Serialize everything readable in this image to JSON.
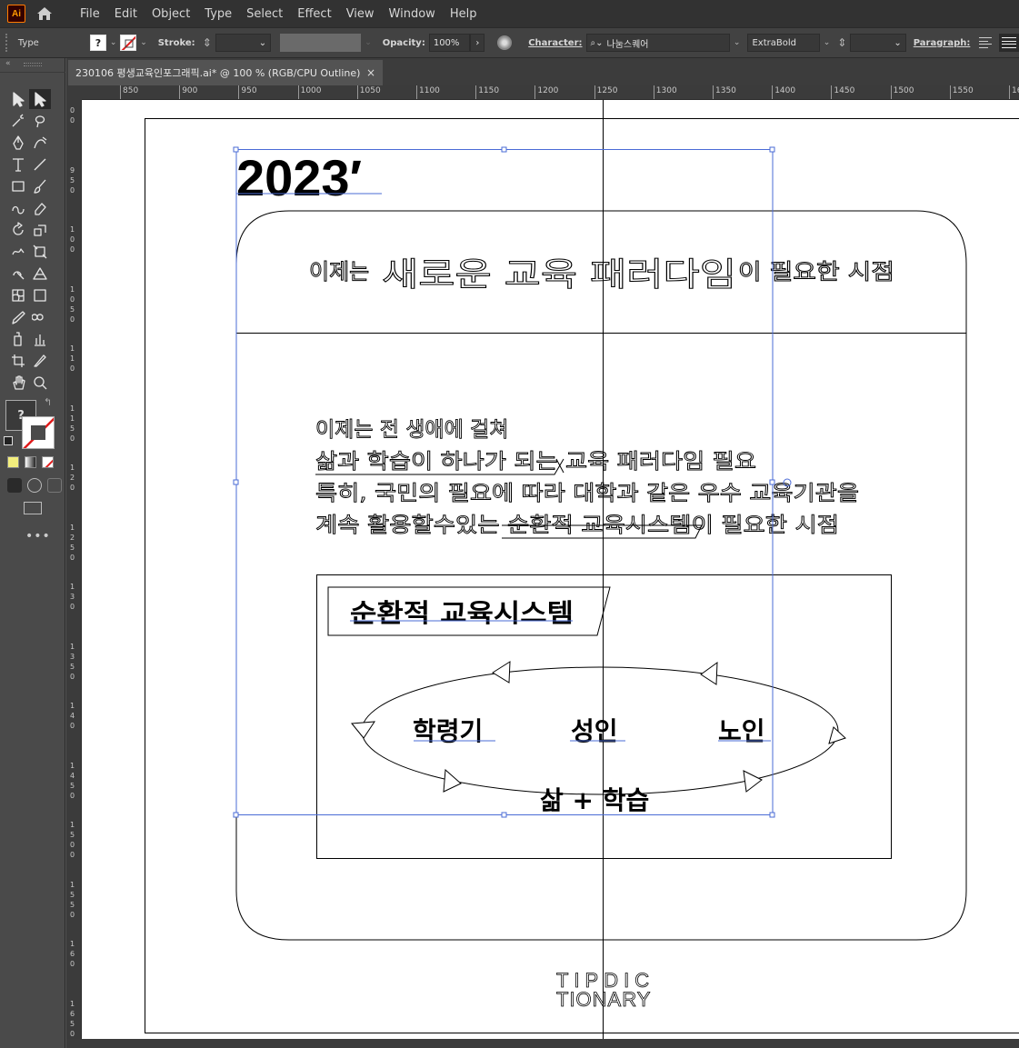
{
  "app": {
    "logo": "Ai",
    "menu": [
      "File",
      "Edit",
      "Object",
      "Type",
      "Select",
      "Effect",
      "View",
      "Window",
      "Help"
    ]
  },
  "control_bar": {
    "mode": "Type",
    "stroke_label": "Stroke:",
    "opacity_label": "Opacity:",
    "opacity_value": "100%",
    "character_label": "Character:",
    "font_name": "나눔스퀘어",
    "font_style": "ExtraBold",
    "paragraph_label": "Paragraph:"
  },
  "document": {
    "tab_title": "230106 평생교육인포그래픽.ai* @ 100 % (RGB/CPU Outline)",
    "close": "×"
  },
  "ruler": {
    "h_ticks": [
      "850",
      "900",
      "950",
      "1000",
      "1050",
      "1100",
      "1150",
      "1200",
      "1250",
      "1300",
      "1350",
      "1400",
      "1450",
      "1500",
      "1550",
      "16"
    ],
    "v_ticks": [
      "0\n0",
      "9\n5\n0",
      "1\n0\n0",
      "1\n0\n5\n0",
      "1\n1\n0",
      "1\n1\n5\n0",
      "1\n2\n0",
      "1\n2\n5\n0",
      "1\n3\n0",
      "1\n3\n5\n0",
      "1\n4\n0",
      "1\n4\n5\n0",
      "1\n5\n0\n0",
      "1\n5\n5\n0",
      "1\n6\n0",
      "1\n6\n5\n0"
    ]
  },
  "artwork": {
    "year": "2023′",
    "headline_small_1": "이제는",
    "headline_large": "새로운 교육 패러다임",
    "headline_small_2": "이 필요한 시점",
    "body_lines": [
      "이제는 전 생애에 걸쳐",
      "삶과 학습이 하나가 되는 교육 패러다임 필요",
      "특히, 국민의 필요에 따라 대학과 같은 우수 교육기관을",
      "계속 활용할수있는 순환적 교육시스템이 필요한 시점"
    ],
    "system_title": "순환적 교육시스템",
    "stage_1": "학령기",
    "stage_2": "성인",
    "stage_3": "노인",
    "center_label": "삶 + 학습",
    "logo_line_1": "TIPDIC",
    "logo_line_2": "TIONARY"
  },
  "colors": {
    "menubar": "#323232",
    "panel": "#424242",
    "selection": "#4a6bd6",
    "accent": "#ff9a00"
  }
}
